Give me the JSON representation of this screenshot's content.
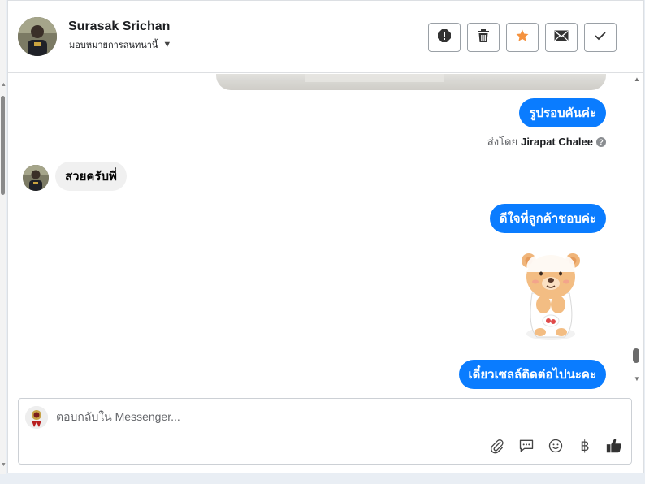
{
  "contact": {
    "name": "Surasak Srichan",
    "assign_label": "มอบหมายการสนทนานี้"
  },
  "toolbar": {
    "buttons": [
      {
        "icon": "alert-icon",
        "color": "#333333"
      },
      {
        "icon": "trash-icon",
        "color": "#333333"
      },
      {
        "icon": "star-icon",
        "color": "#f5923e"
      },
      {
        "icon": "envelope-icon",
        "color": "#333333"
      },
      {
        "icon": "check-icon",
        "color": "#333333"
      }
    ]
  },
  "messages": [
    {
      "type": "outgoing",
      "text": "รูปรอบคันค่ะ"
    },
    {
      "type": "sent_by",
      "prefix": "ส่งโดย",
      "agent": "Jirapat Chalee",
      "help": "?"
    },
    {
      "type": "incoming",
      "text": "สวยครับพี่"
    },
    {
      "type": "outgoing",
      "text": "ดีใจที่ลูกค้าชอบค่ะ"
    },
    {
      "type": "sticker",
      "icon": "bear-sticker-icon"
    },
    {
      "type": "outgoing",
      "text": "เดี๋ยวเซลล์ติดต่อไปนะคะ"
    }
  ],
  "composer": {
    "placeholder": "ตอบกลับใน Messenger...",
    "tools": [
      "paperclip-icon",
      "saved-reply-icon",
      "emoji-icon",
      "baht-icon",
      "thumbs-up-icon"
    ],
    "baht_symbol": "฿"
  },
  "colors": {
    "accent": "#0a7cff",
    "incoming_bubble": "#f0f0f0",
    "star": "#f5923e"
  }
}
